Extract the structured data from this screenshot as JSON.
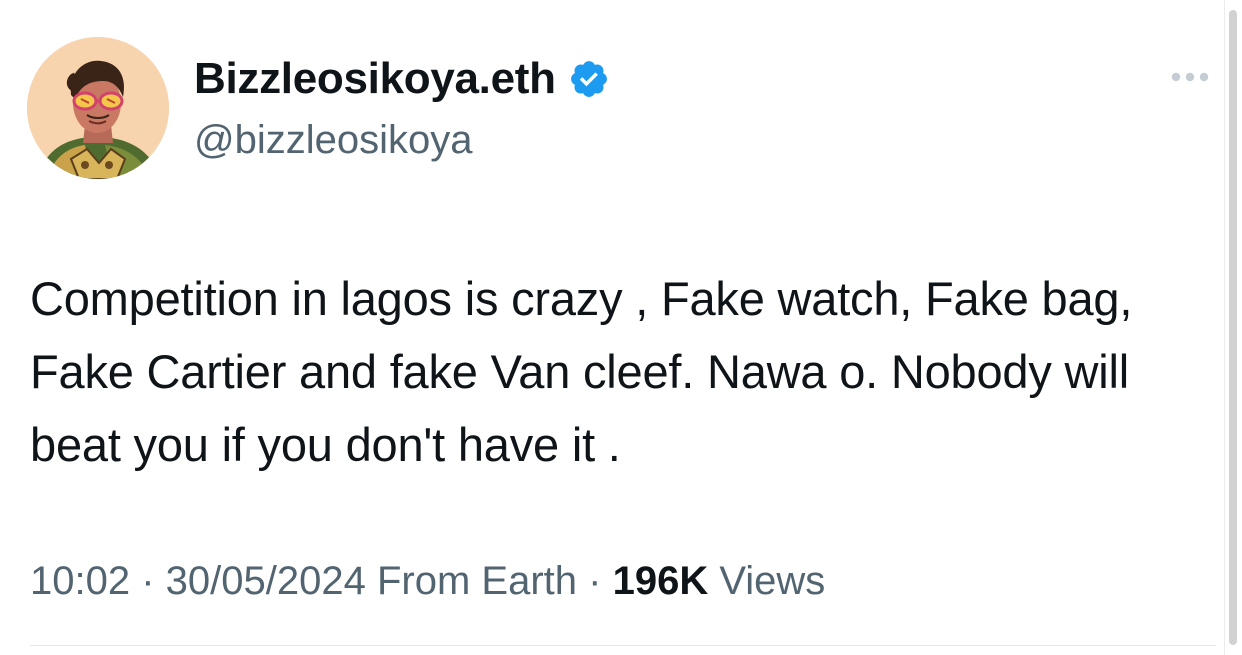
{
  "author": {
    "display_name": "Bizzleosikoya.eth",
    "handle": "@bizzleosikoya",
    "verified": true,
    "avatar_icon": "illustrated-portrait-avatar"
  },
  "tweet": {
    "text": "Competition in lagos is crazy , Fake watch, Fake bag, Fake Cartier and fake Van cleef. Nawa o. Nobody will beat you if you don't have it ."
  },
  "meta": {
    "time": "10:02",
    "separator": " · ",
    "date": "30/05/2024",
    "source": "From Earth",
    "views_count": "196K",
    "views_label": "Views"
  },
  "icons": {
    "verified": "verified-badge-icon",
    "more": "more-options-icon"
  },
  "colors": {
    "verified_blue": "#1d9bf0",
    "text_primary": "#0f1419",
    "text_secondary": "#536471"
  }
}
